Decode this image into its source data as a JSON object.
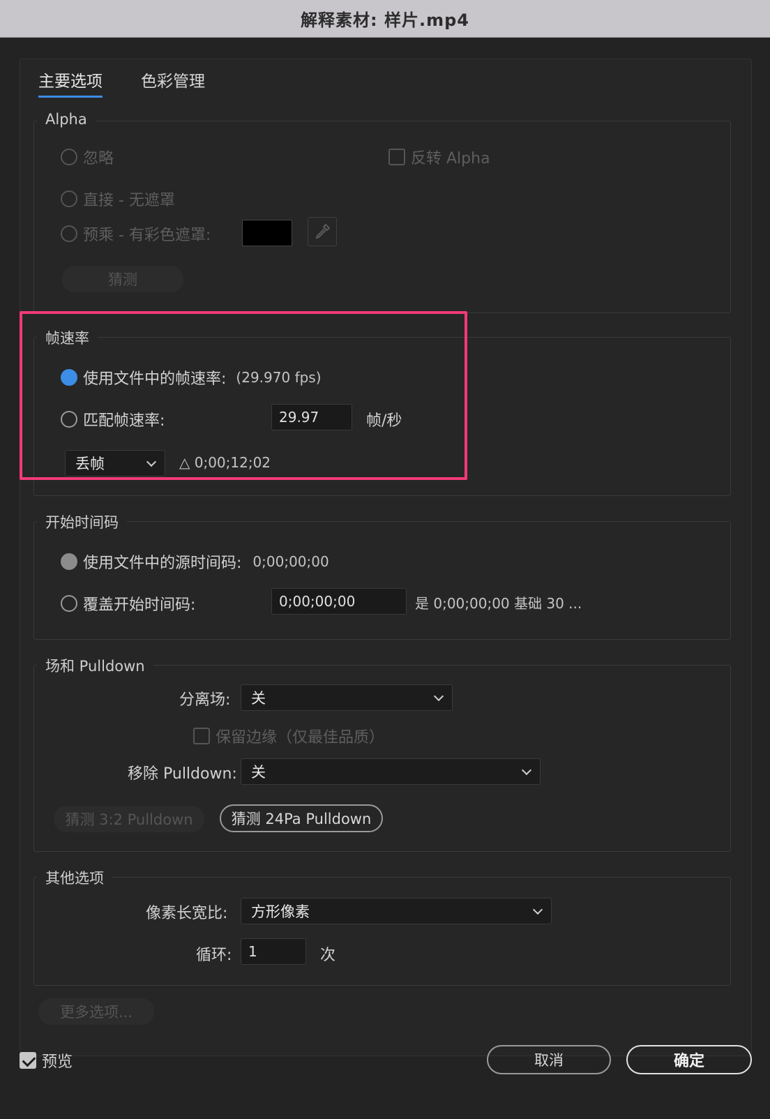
{
  "window": {
    "title": "解释素材: 样片.mp4"
  },
  "tabs": [
    {
      "label": "主要选项",
      "active": true
    },
    {
      "label": "色彩管理",
      "active": false
    }
  ],
  "alpha": {
    "legend": "Alpha",
    "ignore": "忽略",
    "invert": "反转 Alpha",
    "straight": "直接 - 无遮罩",
    "premultiplied": "预乘 - 有彩色遮罩:",
    "matte_color": "#000000",
    "guess": "猜测"
  },
  "framerate": {
    "legend": "帧速率",
    "use_file": "使用文件中的帧速率:",
    "file_fps": "(29.970 fps)",
    "conform": "匹配帧速率:",
    "conform_value": "29.97",
    "unit": "帧/秒",
    "drop_frame": "丢帧",
    "delta": "△ 0;00;12;02"
  },
  "timecode": {
    "legend": "开始时间码",
    "use_file": "使用文件中的源时间码:",
    "file_tc": "0;00;00;00",
    "override": "覆盖开始时间码:",
    "override_value": "0;00;00;00",
    "info": "是 0;00;00;00  基础 30 ..."
  },
  "fields": {
    "legend": "场和 Pulldown",
    "separate_label": "分离场:",
    "separate_value": "关",
    "preserve_edges": "保留边缘（仅最佳品质）",
    "remove_label": "移除 Pulldown:",
    "remove_value": "关",
    "guess32": "猜测 3:2 Pulldown",
    "guess24": "猜测 24Pa Pulldown"
  },
  "other": {
    "legend": "其他选项",
    "par_label": "像素长宽比:",
    "par_value": "方形像素",
    "loop_label": "循环:",
    "loop_value": "1",
    "loop_unit": "次"
  },
  "more_options": "更多选项...",
  "footer": {
    "preview": "预览",
    "cancel": "取消",
    "ok": "确定"
  },
  "colors": {
    "accent": "#3b8de6",
    "highlight": "#f23a77"
  }
}
